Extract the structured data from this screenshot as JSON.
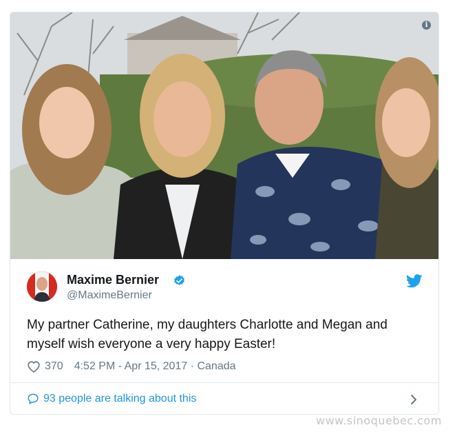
{
  "tweet": {
    "author_name": "Maxime Bernier",
    "author_handle": "@MaximeBernier",
    "text": "My partner Catherine, my daughters Charlotte and Megan and myself wish everyone a very happy Easter!",
    "likes": "370",
    "time_location": "4:52 PM - Apr 15, 2017 · Canada",
    "talking_link": "93 people are talking about this",
    "verified": true
  },
  "icons": {
    "info": "info-icon",
    "verified": "verified-badge-icon",
    "twitter": "twitter-bird-icon",
    "like": "heart-icon",
    "reply": "speech-bubble-icon",
    "more": "chevron-right-icon"
  },
  "info_glyph": "i",
  "watermark": "www.sinoquebec.com",
  "colors": {
    "link_blue": "#1b95e0",
    "text_gray": "#657786",
    "border": "#e1e8ed",
    "twitter_blue": "#1da1f2"
  }
}
